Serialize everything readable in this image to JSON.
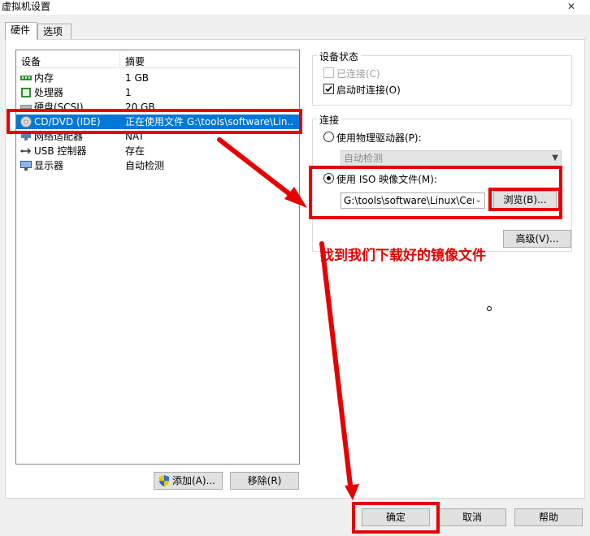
{
  "window": {
    "title": "虚拟机设置",
    "close_glyph": "✕"
  },
  "tabs": [
    {
      "label": "硬件"
    },
    {
      "label": "选项"
    }
  ],
  "device_list": {
    "col_device": "设备",
    "col_summary": "摘要",
    "rows": [
      {
        "device": "内存",
        "summary": "1 GB",
        "icon": "memory-icon"
      },
      {
        "device": "处理器",
        "summary": "1",
        "icon": "processor-icon"
      },
      {
        "device": "硬盘(SCSI)",
        "summary": "20 GB",
        "icon": "hard-disk-icon"
      },
      {
        "device": "CD/DVD (IDE)",
        "summary": "正在使用文件 G:\\tools\\software\\Lin...",
        "icon": "cd-dvd-icon",
        "selected": true
      },
      {
        "device": "网络适配器",
        "summary": "NAT",
        "icon": "network-adapter-icon"
      },
      {
        "device": "USB 控制器",
        "summary": "存在",
        "icon": "usb-icon"
      },
      {
        "device": "显示器",
        "summary": "自动检测",
        "icon": "monitor-icon"
      }
    ]
  },
  "buttons": {
    "add": "添加(A)...",
    "remove": "移除(R)",
    "browse": "浏览(B)...",
    "advanced": "高级(V)...",
    "ok": "确定",
    "cancel": "取消",
    "help": "帮助"
  },
  "device_status": {
    "title": "设备状态",
    "connected": "已连接(C)",
    "connect_at_power_on": "启动时连接(O)",
    "connected_checked": false,
    "connect_at_power_on_checked": true
  },
  "connection": {
    "title": "连接",
    "physical_drive": "使用物理驱动器(P):",
    "physical_drive_value": "自动检测",
    "iso_file": "使用 ISO 映像文件(M):",
    "iso_path": "G:\\tools\\software\\Linux\\Cer"
  },
  "annotation": "找到我们下载好的镜像文件",
  "colors": {
    "highlight": "#e60000",
    "selection": "#0078d7"
  }
}
